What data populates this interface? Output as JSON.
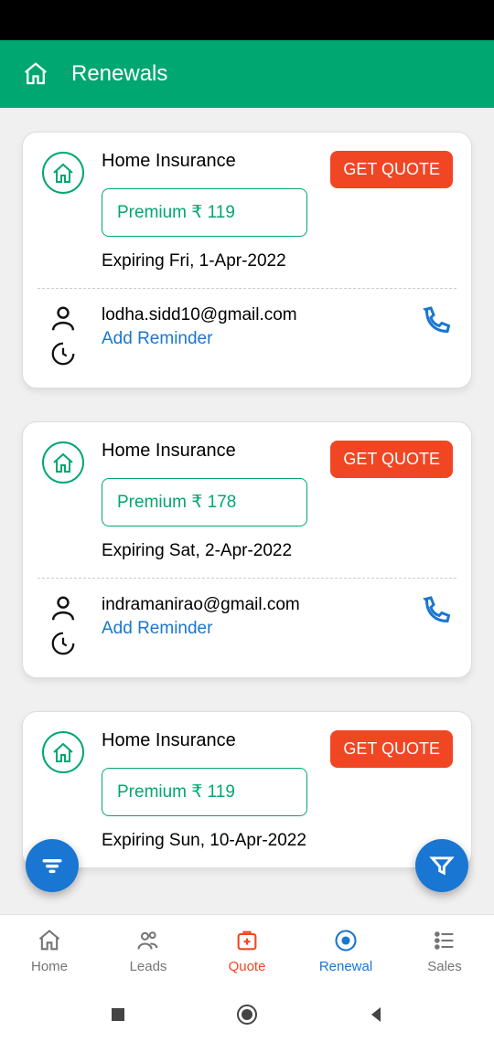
{
  "header": {
    "title": "Renewals"
  },
  "quote_button_label": "GET QUOTE",
  "add_reminder_label": "Add Reminder",
  "cards": [
    {
      "title": "Home Insurance",
      "premium": "Premium ₹ 119",
      "expiry": "Expiring Fri, 1-Apr-2022",
      "email": "lodha.sidd10@gmail.com"
    },
    {
      "title": "Home Insurance",
      "premium": "Premium ₹ 178",
      "expiry": "Expiring Sat, 2-Apr-2022",
      "email": "indramanirao@gmail.com"
    },
    {
      "title": "Home Insurance",
      "premium": "Premium ₹ 119",
      "expiry": "Expiring Sun, 10-Apr-2022",
      "email": ""
    }
  ],
  "nav": {
    "home": "Home",
    "leads": "Leads",
    "quote": "Quote",
    "renewal": "Renewal",
    "sales": "Sales"
  },
  "colors": {
    "primary": "#00a770",
    "accent": "#f04624",
    "link": "#1976d2"
  }
}
